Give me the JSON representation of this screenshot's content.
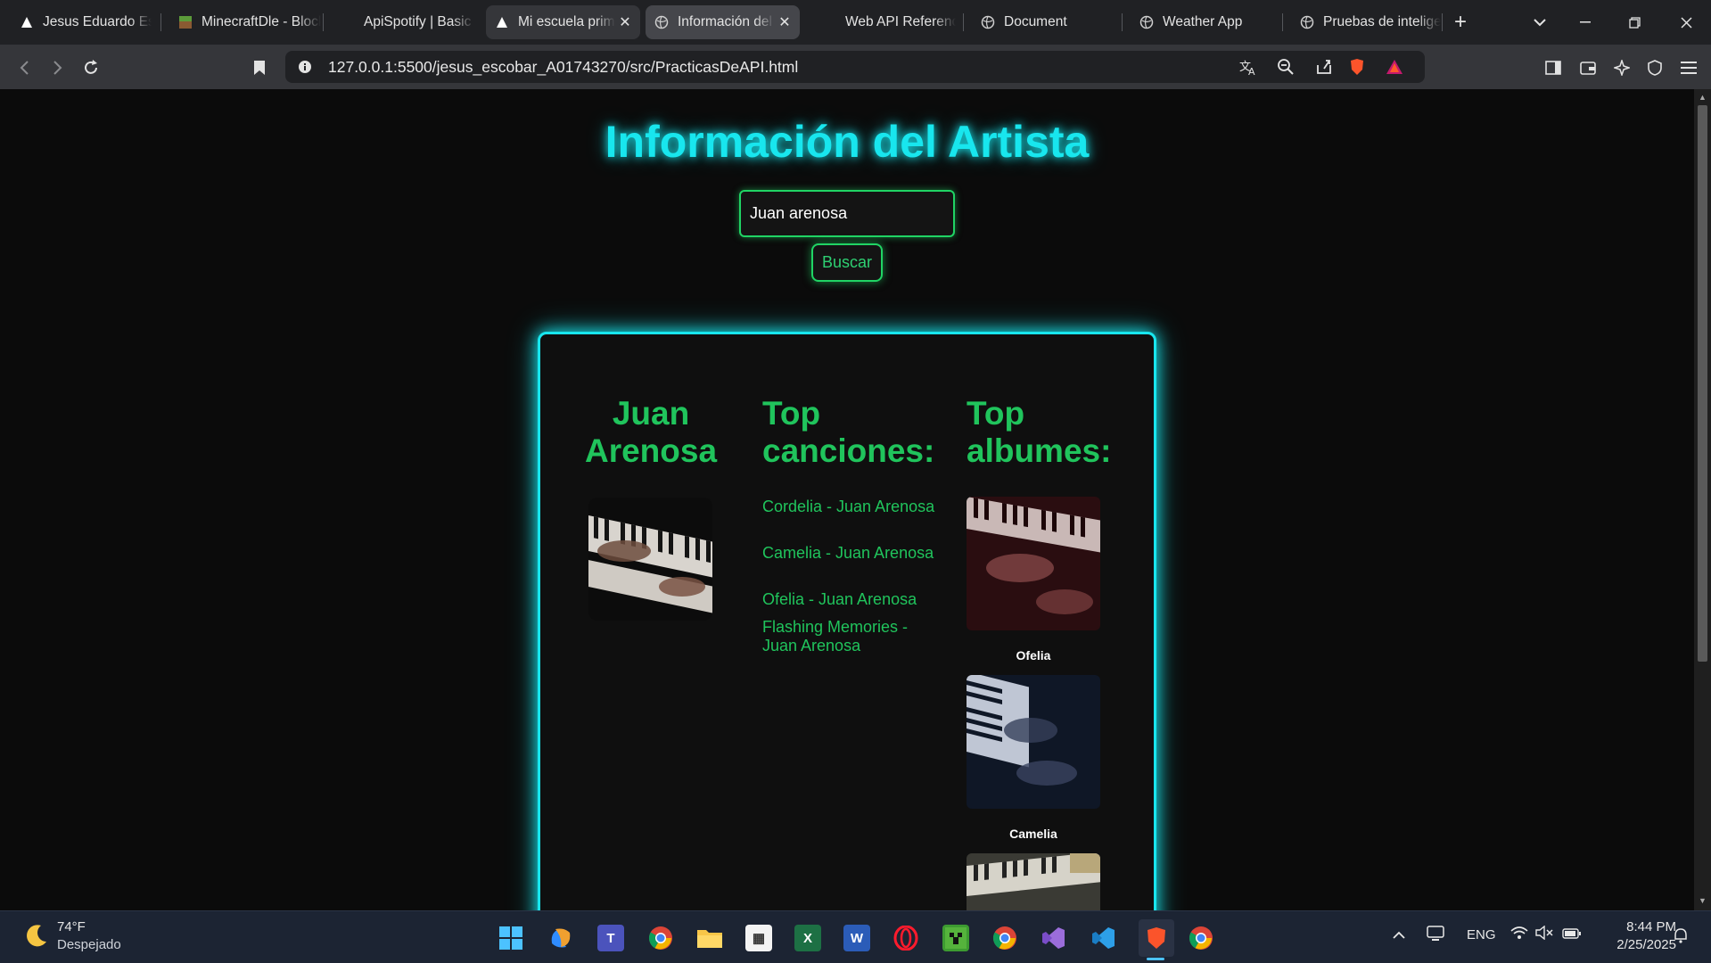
{
  "browser": {
    "tabs": [
      {
        "title": "Jesus Eduardo Escobar"
      },
      {
        "title": "MinecraftDle - Block"
      },
      {
        "title": "ApiSpotify | Basic"
      },
      {
        "title": "Mi escuela primaria"
      },
      {
        "title": "Información del Artista"
      },
      {
        "title": "Web API Reference"
      },
      {
        "title": "Document"
      },
      {
        "title": "Weather App"
      },
      {
        "title": "Pruebas de inteligencia"
      }
    ],
    "url": "127.0.0.1:5500/jesus_escobar_A01743270/src/PracticasDeAPI.html"
  },
  "page": {
    "title": "Información del Artista",
    "search_value": "Juan arenosa",
    "search_button": "Buscar",
    "artist_name_line1": "Juan",
    "artist_name_line2": "Arenosa",
    "top_songs_line1": "Top",
    "top_songs_line2": "canciones:",
    "top_albums_line1": "Top",
    "top_albums_line2": "albumes:",
    "songs": [
      "Cordelia - Juan Arenosa",
      "Camelia - Juan Arenosa",
      "Ofelia - Juan Arenosa",
      "Flashing Memories - Juan Arenosa"
    ],
    "albums": [
      "Ofelia",
      "Camelia"
    ]
  },
  "taskbar": {
    "temperature": "74°F",
    "weather": "Despejado",
    "language": "ENG",
    "time": "8:44 PM",
    "date": "2/25/2025"
  },
  "colors": {
    "title_cyan": "#18e6ee",
    "accent_green": "#20c45c",
    "background": "#0b0b0b"
  }
}
